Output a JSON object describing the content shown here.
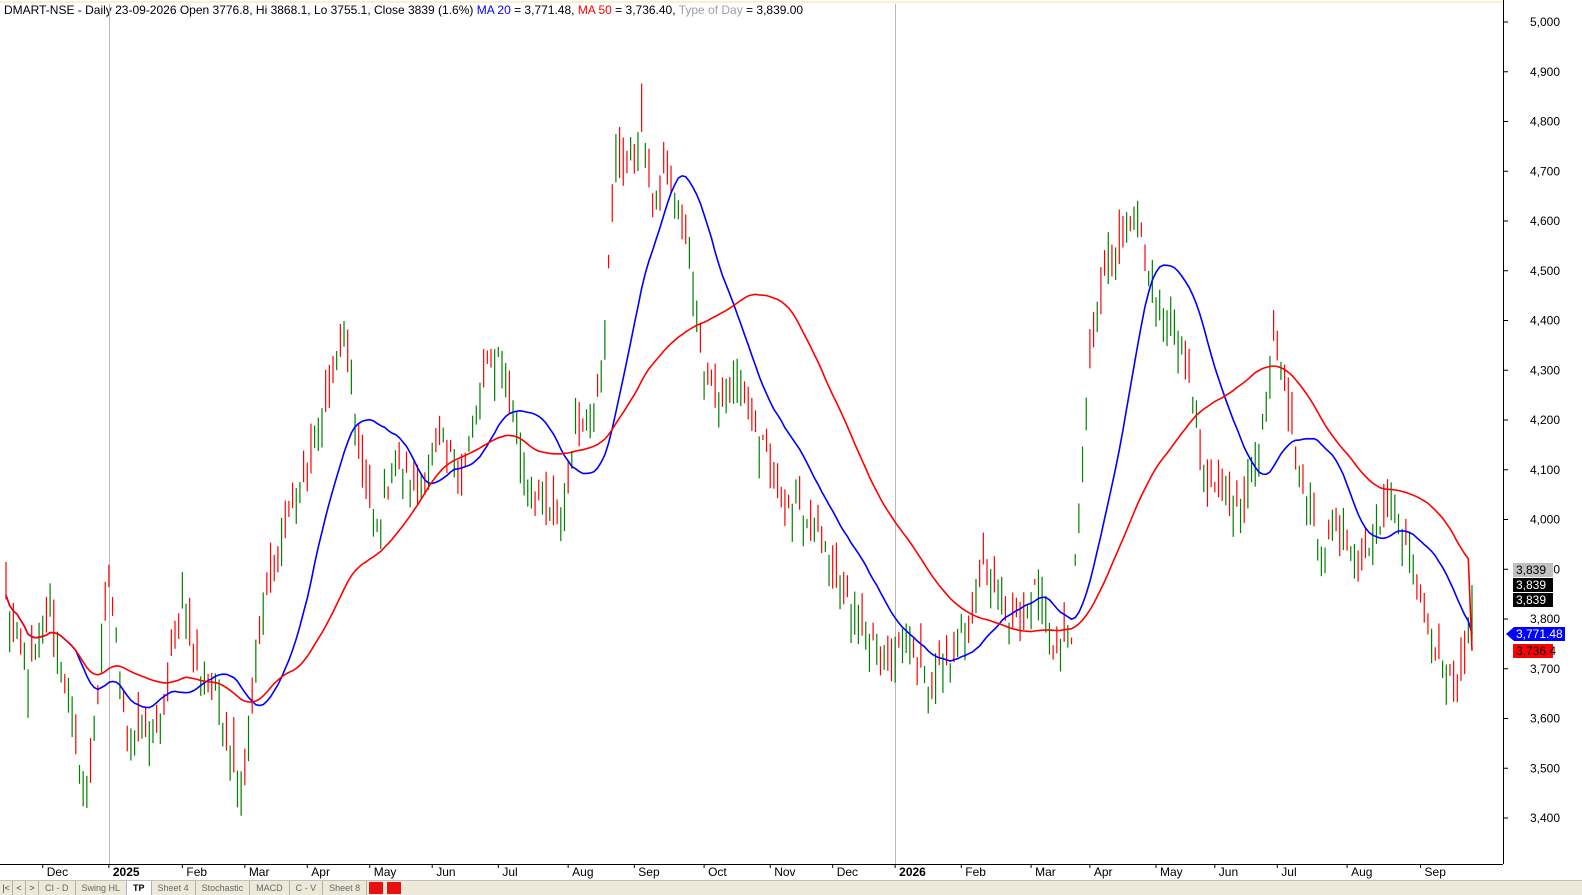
{
  "header": {
    "symbol_info": "DMART-NSE - Daily 23-09-2026 Open 3776.8, Hi 3868.1, Lo 3755.1, Close 3839 (1.6%) ",
    "ma20_label": "MA 20",
    "ma20_value": " = 3,771.48, ",
    "ma50_label": "MA 50",
    "ma50_value": " = 3,736.40, ",
    "tod_label": "Type of Day",
    "tod_value": " = 3,839.00"
  },
  "chart_data": {
    "type": "candlestick",
    "title": "DMART-NSE - Daily",
    "y_axis": {
      "min": 3340,
      "max": 5040,
      "ticks": [
        3400,
        3500,
        3600,
        3700,
        3800,
        3900,
        4000,
        4100,
        4200,
        4300,
        4400,
        4500,
        4600,
        4700,
        4800,
        4900,
        5000
      ],
      "position": "right"
    },
    "x_axis": {
      "labels": [
        {
          "label": "Dec",
          "bar": 10
        },
        {
          "label": "2025",
          "bar": 28,
          "bold": true
        },
        {
          "label": "Feb",
          "bar": 48
        },
        {
          "label": "Mar",
          "bar": 65
        },
        {
          "label": "Apr",
          "bar": 82
        },
        {
          "label": "May",
          "bar": 99
        },
        {
          "label": "Jun",
          "bar": 116
        },
        {
          "label": "Jul",
          "bar": 134
        },
        {
          "label": "Aug",
          "bar": 153
        },
        {
          "label": "Sep",
          "bar": 171
        },
        {
          "label": "Oct",
          "bar": 190
        },
        {
          "label": "Nov",
          "bar": 208
        },
        {
          "label": "Dec",
          "bar": 225
        },
        {
          "label": "2026",
          "bar": 242,
          "bold": true
        },
        {
          "label": "Feb",
          "bar": 260
        },
        {
          "label": "Mar",
          "bar": 279
        },
        {
          "label": "Apr",
          "bar": 295
        },
        {
          "label": "May",
          "bar": 313
        },
        {
          "label": "Jun",
          "bar": 329
        },
        {
          "label": "Jul",
          "bar": 346
        },
        {
          "label": "Aug",
          "bar": 365
        },
        {
          "label": "Sep",
          "bar": 385
        }
      ],
      "year_separators": [
        28,
        242
      ]
    },
    "key_points": [
      [
        0,
        3840
      ],
      [
        6,
        3690
      ],
      [
        12,
        3820
      ],
      [
        22,
        3440
      ],
      [
        28,
        3870
      ],
      [
        33,
        3570
      ],
      [
        38,
        3570
      ],
      [
        42,
        3580
      ],
      [
        48,
        3850
      ],
      [
        52,
        3700
      ],
      [
        58,
        3640
      ],
      [
        64,
        3460
      ],
      [
        70,
        3820
      ],
      [
        76,
        4000
      ],
      [
        82,
        4100
      ],
      [
        88,
        4260
      ],
      [
        92,
        4380
      ],
      [
        97,
        4100
      ],
      [
        101,
        3990
      ],
      [
        106,
        4120
      ],
      [
        112,
        4060
      ],
      [
        118,
        4140
      ],
      [
        124,
        4100
      ],
      [
        130,
        4280
      ],
      [
        134,
        4340
      ],
      [
        137,
        4260
      ],
      [
        142,
        4080
      ],
      [
        147,
        4020
      ],
      [
        151,
        4000
      ],
      [
        155,
        4190
      ],
      [
        160,
        4220
      ],
      [
        163,
        4380
      ],
      [
        166,
        4720
      ],
      [
        170,
        4720
      ],
      [
        173,
        4800
      ],
      [
        176,
        4630
      ],
      [
        180,
        4690
      ],
      [
        185,
        4580
      ],
      [
        190,
        4300
      ],
      [
        195,
        4250
      ],
      [
        200,
        4280
      ],
      [
        205,
        4160
      ],
      [
        210,
        4050
      ],
      [
        215,
        4020
      ],
      [
        220,
        3990
      ],
      [
        225,
        3880
      ],
      [
        230,
        3820
      ],
      [
        236,
        3750
      ],
      [
        241,
        3700
      ],
      [
        246,
        3760
      ],
      [
        251,
        3670
      ],
      [
        256,
        3710
      ],
      [
        261,
        3780
      ],
      [
        266,
        3930
      ],
      [
        271,
        3830
      ],
      [
        276,
        3790
      ],
      [
        281,
        3870
      ],
      [
        285,
        3740
      ],
      [
        290,
        3780
      ],
      [
        295,
        4330
      ],
      [
        299,
        4500
      ],
      [
        304,
        4560
      ],
      [
        308,
        4620
      ],
      [
        313,
        4440
      ],
      [
        318,
        4370
      ],
      [
        322,
        4280
      ],
      [
        326,
        4080
      ],
      [
        331,
        4060
      ],
      [
        336,
        4020
      ],
      [
        341,
        4140
      ],
      [
        345,
        4340
      ],
      [
        348,
        4280
      ],
      [
        353,
        4060
      ],
      [
        358,
        3950
      ],
      [
        364,
        4000
      ],
      [
        368,
        3910
      ],
      [
        373,
        3990
      ],
      [
        378,
        4060
      ],
      [
        382,
        3920
      ],
      [
        387,
        3780
      ],
      [
        392,
        3700
      ],
      [
        396,
        3690
      ],
      [
        399,
        3839
      ]
    ],
    "bar_count": 400,
    "last_bar": {
      "date": "23-09-2026",
      "open": 3776.8,
      "high": 3868.1,
      "low": 3755.1,
      "close": 3839,
      "change_pct": 1.6
    },
    "series": [
      {
        "name": "MA 20",
        "period": 20,
        "color": "#0000ff",
        "last_value": 3771.48
      },
      {
        "name": "MA 50",
        "period": 50,
        "color": "#ff0000",
        "last_value": 3736.4
      }
    ],
    "up_color": "#008000",
    "down_color": "#ff0000",
    "price_tags": [
      {
        "label": "3,839",
        "value": 3839,
        "style": "gray"
      },
      {
        "label": "3,839",
        "value": 3839,
        "style": "black"
      },
      {
        "label": "3,839",
        "value": 3839,
        "style": "black"
      },
      {
        "label": "3,771.48",
        "value": 3771.48,
        "style": "blue"
      },
      {
        "label": "3,736.4",
        "value": 3736.4,
        "style": "red"
      }
    ]
  },
  "tabs": [
    {
      "label": "CI - D",
      "active": false
    },
    {
      "label": "Swing HL",
      "active": false
    },
    {
      "label": "TP",
      "active": true
    },
    {
      "label": "Sheet 4",
      "active": false
    },
    {
      "label": "Stochastic",
      "active": false
    },
    {
      "label": "MACD",
      "active": false
    },
    {
      "label": "C - V",
      "active": false
    },
    {
      "label": "Sheet 8",
      "active": false
    }
  ]
}
